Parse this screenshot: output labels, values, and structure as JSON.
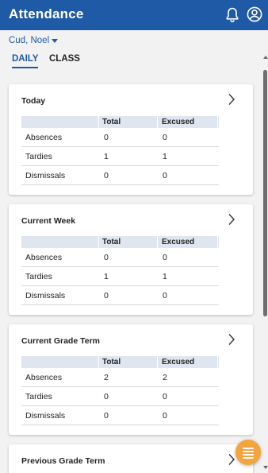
{
  "app": {
    "title": "Attendance"
  },
  "header_icons": [
    "bell-icon",
    "account-icon"
  ],
  "student_selector": {
    "name": "Cud, Noel"
  },
  "tabs": [
    {
      "label": "DAILY",
      "active": true
    },
    {
      "label": "CLASS",
      "active": false
    }
  ],
  "table_headers": {
    "col1": "Total",
    "col2": "Excused"
  },
  "cards": [
    {
      "title": "Today",
      "rows": [
        {
          "label": "Absences",
          "total": "0",
          "excused": "0"
        },
        {
          "label": "Tardies",
          "total": "1",
          "excused": "1"
        },
        {
          "label": "Dismissals",
          "total": "0",
          "excused": "0"
        }
      ]
    },
    {
      "title": "Current Week",
      "rows": [
        {
          "label": "Absences",
          "total": "0",
          "excused": "0"
        },
        {
          "label": "Tardies",
          "total": "1",
          "excused": "1"
        },
        {
          "label": "Dismissals",
          "total": "0",
          "excused": "0"
        }
      ]
    },
    {
      "title": "Current Grade Term",
      "rows": [
        {
          "label": "Absences",
          "total": "2",
          "excused": "2"
        },
        {
          "label": "Tardies",
          "total": "0",
          "excused": "0"
        },
        {
          "label": "Dismissals",
          "total": "0",
          "excused": "0"
        }
      ]
    },
    {
      "title": "Previous Grade Term",
      "rows": []
    }
  ],
  "colors": {
    "accent": "#1f5aa7",
    "fab": "#f4a43c",
    "table_header_bg": "#dfe6ef"
  }
}
